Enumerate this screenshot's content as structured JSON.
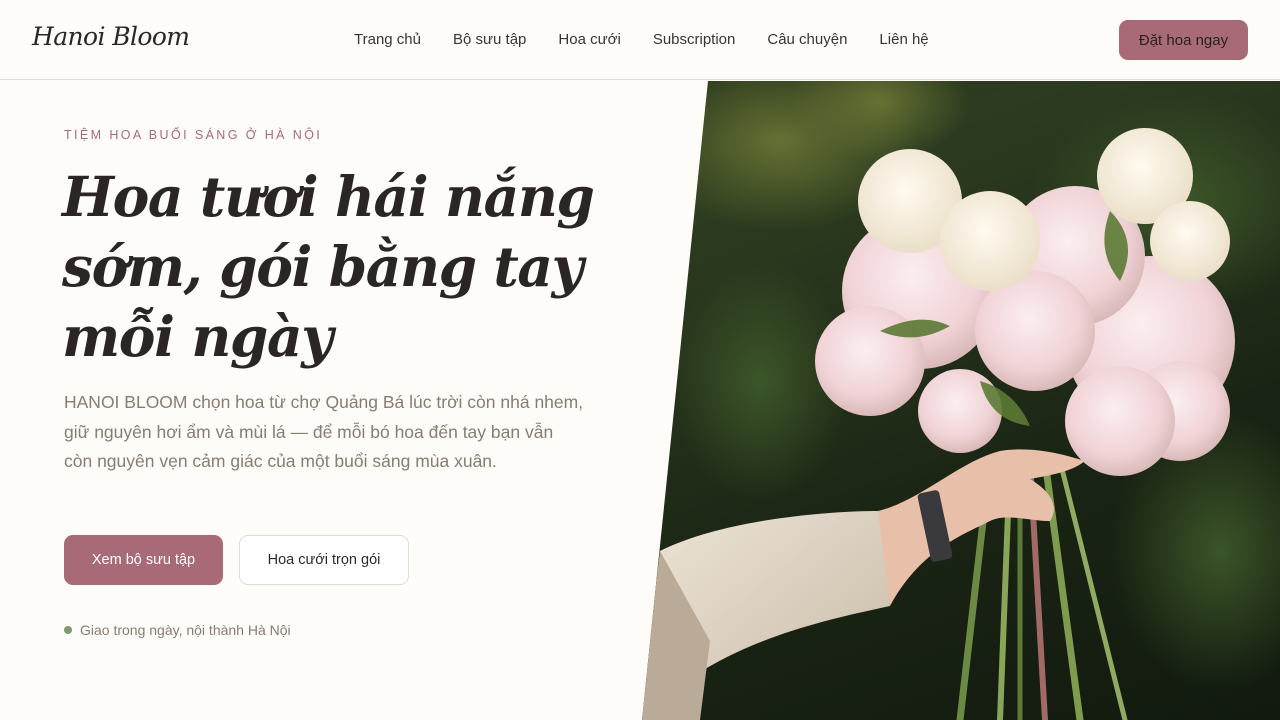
{
  "brand": {
    "name": "Hanoi Bloom"
  },
  "nav": {
    "items": [
      "Trang chủ",
      "Bộ sưu tập",
      "Hoa cưới",
      "Subscription",
      "Câu chuyện",
      "Liên hệ"
    ],
    "cta": "Đặt hoa ngay"
  },
  "hero": {
    "eyebrow": "TIỆM HOA BUỔI SÁNG Ở HÀ NỘI",
    "title_lines": [
      "Hoa tươi hái nắng",
      "sớm, gói bằng tay",
      "mỗi ngày"
    ],
    "lede": "HANOI BLOOM chọn hoa từ chợ Quảng Bá lúc trời còn nhá nhem, giữ nguyên hơi ẩm và mùi lá — để mỗi bó hoa đến tay bạn vẫn còn nguyên vẹn cảm giác của một buổi sáng mùa xuân.",
    "primary_button": "Xem bộ sưu tập",
    "secondary_button": "Hoa cưới trọn gói",
    "delivery_note": "Giao trong ngày, nội thành Hà Nội"
  },
  "colors": {
    "accent": "#a86a76",
    "background": "#fdfcf8",
    "muted_text": "#8a7b73",
    "dot": "#7f9a6e"
  }
}
